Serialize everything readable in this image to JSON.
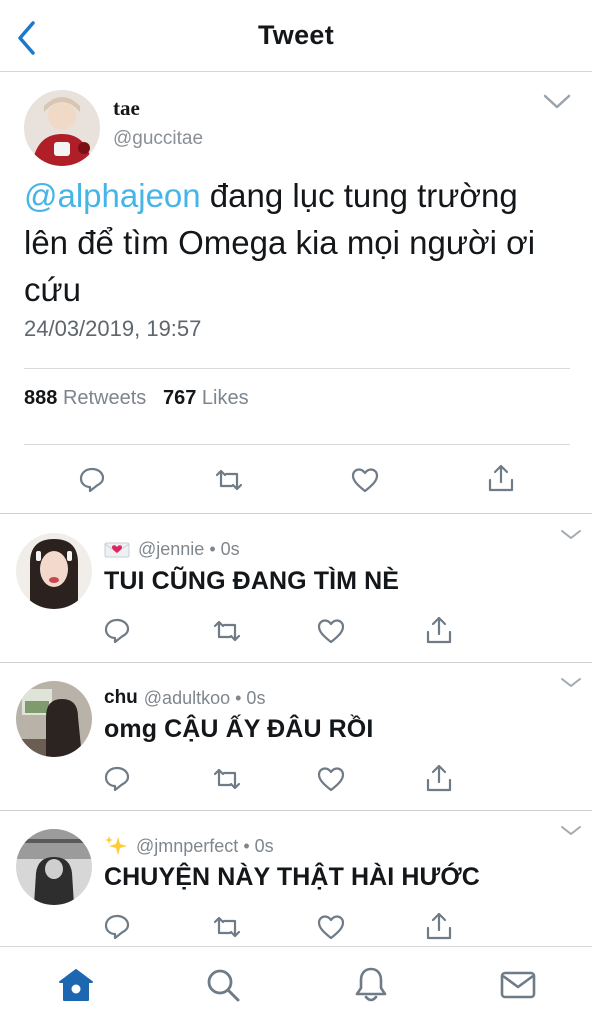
{
  "header": {
    "title": "Tweet",
    "back_icon": "chevron-left-icon"
  },
  "main_tweet": {
    "author_name": "tae",
    "author_handle": "@guccitae",
    "mention": "@alphajeon",
    "text": " đang lục tung trường lên để tìm Omega kia mọi người ơi cứu",
    "date": "24/03/2019, 19:57",
    "retweets_count": "888",
    "retweets_label": "Retweets",
    "likes_count": "767",
    "likes_label": "Likes",
    "actions": [
      "reply-icon",
      "retweet-icon",
      "like-icon",
      "share-icon"
    ]
  },
  "replies": [
    {
      "name": "",
      "emoji": "love-letter-emoji",
      "handle": "@jennie",
      "time": "• 0s",
      "text": "TUI CŨNG ĐANG TÌM NÈ"
    },
    {
      "name": "chu",
      "emoji": "",
      "handle": "@adultkoo",
      "time": "• 0s",
      "text": "omg CẬU ẤY ĐÂU RỒI"
    },
    {
      "name": "",
      "emoji": "sparkles-emoji",
      "handle": "@jmnperfect",
      "time": "• 0s",
      "text": "CHUYỆN NÀY THẬT HÀI HƯỚC"
    }
  ],
  "tabbar": {
    "items": [
      "home-icon",
      "search-icon",
      "notifications-icon",
      "messages-icon"
    ],
    "active": "home-icon"
  },
  "colors": {
    "accent": "#1d67b1",
    "mention": "#45b5e8",
    "icon_gray": "#6f7b86",
    "text": "#14171a",
    "secondary_text": "#7f878e"
  }
}
